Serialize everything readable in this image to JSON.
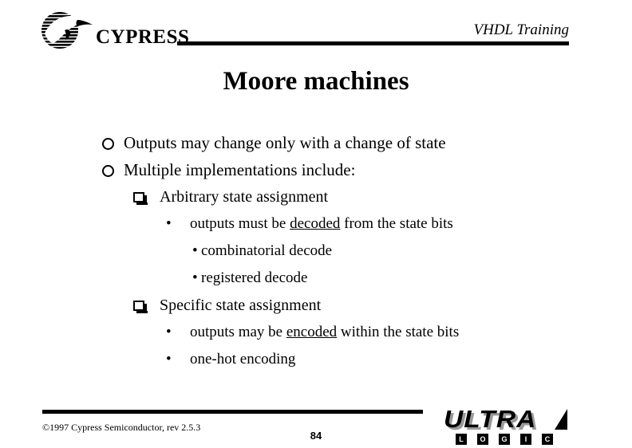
{
  "header": {
    "logo_wordmark": "CYPRESS",
    "logo_icon": "cypress-globe-logo",
    "course_title": "VHDL Training"
  },
  "slide": {
    "title": "Moore machines",
    "page_number": "84"
  },
  "bullets": [
    {
      "level": 1,
      "marker": "shaded-circle",
      "text": "Outputs may change only with a change of state"
    },
    {
      "level": 1,
      "marker": "shaded-circle",
      "text": "Multiple implementations include:"
    },
    {
      "level": 2,
      "marker": "hollow-square",
      "text": "Arbitrary state assignment"
    },
    {
      "level": 3,
      "marker": "round-bullet",
      "text_before": "outputs must be ",
      "text_emphasis": "decoded",
      "text_after": " from the state bits"
    },
    {
      "level": 4,
      "marker": "round-bullet",
      "text": "combinatorial decode"
    },
    {
      "level": 4,
      "marker": "round-bullet",
      "text": "registered decode"
    },
    {
      "level": 2,
      "marker": "hollow-square",
      "text": "Specific state assignment"
    },
    {
      "level": 3,
      "marker": "round-bullet",
      "text_before": "outputs may be ",
      "text_emphasis": "encoded",
      "text_after": " within the state bits"
    },
    {
      "level": 3,
      "marker": "round-bullet",
      "text": "one-hot encoding"
    }
  ],
  "markers": {
    "round_bullet_glyph": "•"
  },
  "footer": {
    "copyright": "©1997 Cypress Semiconductor, rev 2.5.3",
    "brand_logo": {
      "word": "ULTRA",
      "sub_letters": [
        "L",
        "O",
        "G",
        "I",
        "C"
      ]
    }
  },
  "colors": {
    "text": "#000000",
    "background": "#ffffff",
    "logo_shadow": "#9a9a9a"
  }
}
